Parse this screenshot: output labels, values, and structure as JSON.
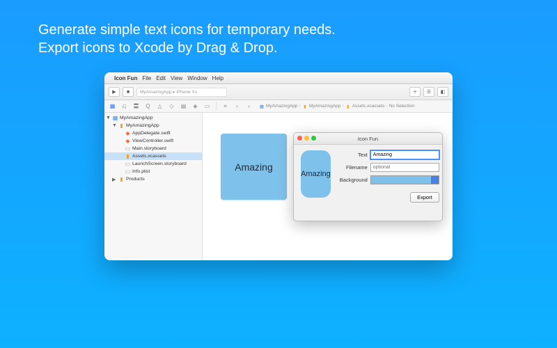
{
  "hero": {
    "line1": "Generate simple text icons for temporary needs.",
    "line2": "Export icons to Xcode by Drag & Drop."
  },
  "menubar": {
    "app": "Icon Fun",
    "items": [
      "File",
      "Edit",
      "View",
      "Window",
      "Help"
    ]
  },
  "toolbar": {
    "scheme": "MyAmazingApp ▸ iPhone Xs"
  },
  "breadcrumb": [
    "MyAmazingApp",
    "MyAmazingApp",
    "Assets.xcassets",
    "No Selection"
  ],
  "project": {
    "root": "MyAmazingApp",
    "group": "MyAmazingApp",
    "files": [
      "AppDelegate.swift",
      "ViewController.swift",
      "Main.storyboard",
      "Assets.xcassets",
      "LaunchScreen.storyboard",
      "Info.plist"
    ],
    "products": "Products"
  },
  "artboard": {
    "text": "Amazing"
  },
  "iconfun": {
    "window_title": "Icon Fun",
    "preview_text": "Amazing",
    "fields": {
      "text_label": "Text",
      "text_value": "Amazing",
      "filename_label": "Filename",
      "filename_placeholder": "optional",
      "background_label": "Background"
    },
    "export_label": "Export"
  },
  "colors": {
    "icon_bg": "#7ec1eb"
  }
}
